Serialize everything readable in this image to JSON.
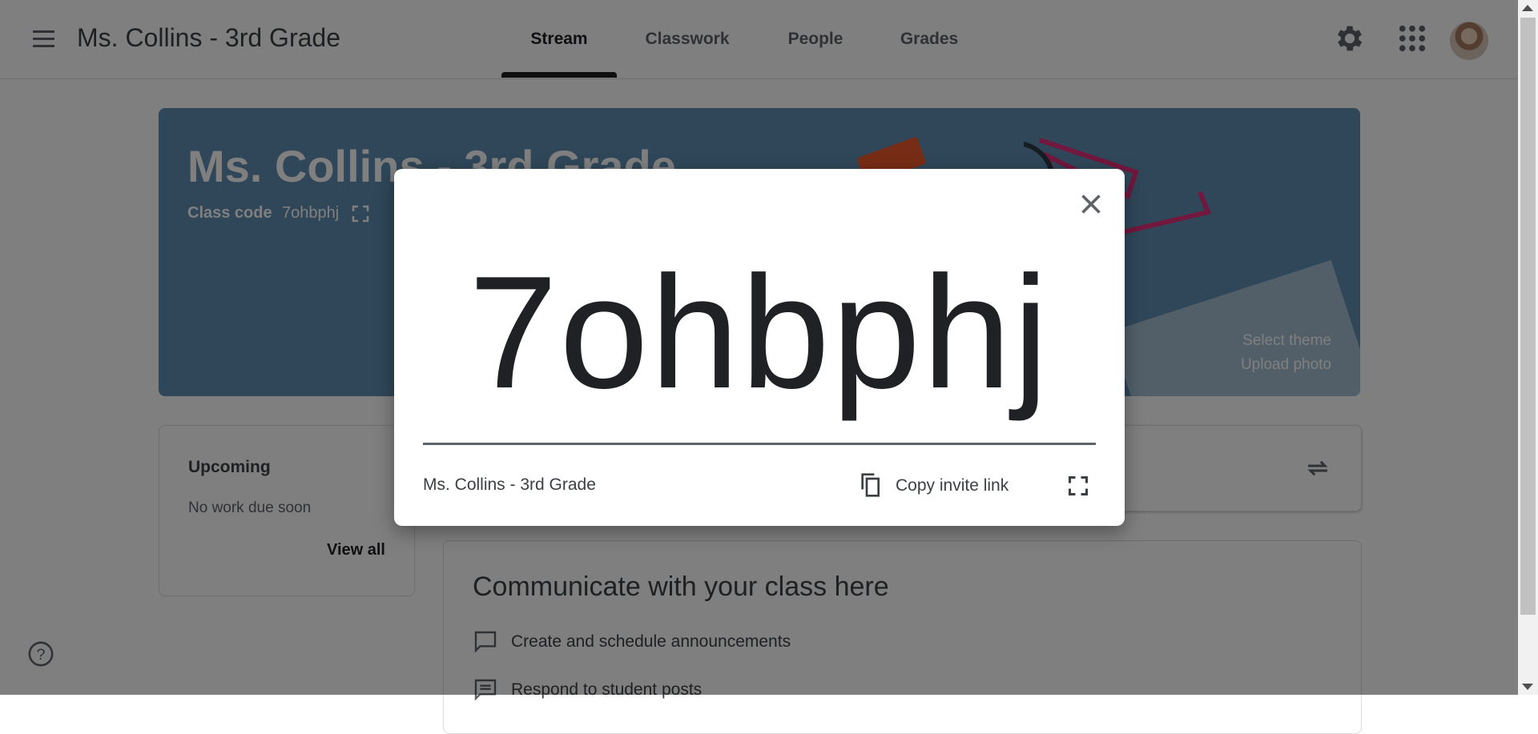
{
  "header": {
    "title": "Ms. Collins - 3rd Grade",
    "tabs": [
      "Stream",
      "Classwork",
      "People",
      "Grades"
    ],
    "active_tab": "Stream"
  },
  "banner": {
    "title": "Ms. Collins - 3rd Grade",
    "class_code_label": "Class code",
    "class_code": "7ohbphj",
    "select_theme": "Select theme",
    "upload_photo": "Upload photo"
  },
  "upcoming": {
    "heading": "Upcoming",
    "empty_text": "No work due soon",
    "view_all": "View all"
  },
  "communicate": {
    "heading": "Communicate with your class here",
    "items": [
      "Create and schedule announcements",
      "Respond to student posts"
    ]
  },
  "dialog": {
    "code": "7ohbphj",
    "class_name": "Ms. Collins - 3rd Grade",
    "copy_link_label": "Copy invite link"
  },
  "colors": {
    "banner": "#5f8fb3",
    "scrim": "rgba(0,0,0,0.5)",
    "accent_clip": "#e52f7b"
  },
  "icons": [
    "menu-icon",
    "settings-icon",
    "apps-icon",
    "avatar",
    "expand-icon",
    "repeat-icon",
    "help-icon",
    "close-icon",
    "copy-icon",
    "fullscreen-icon",
    "comment-icon"
  ]
}
